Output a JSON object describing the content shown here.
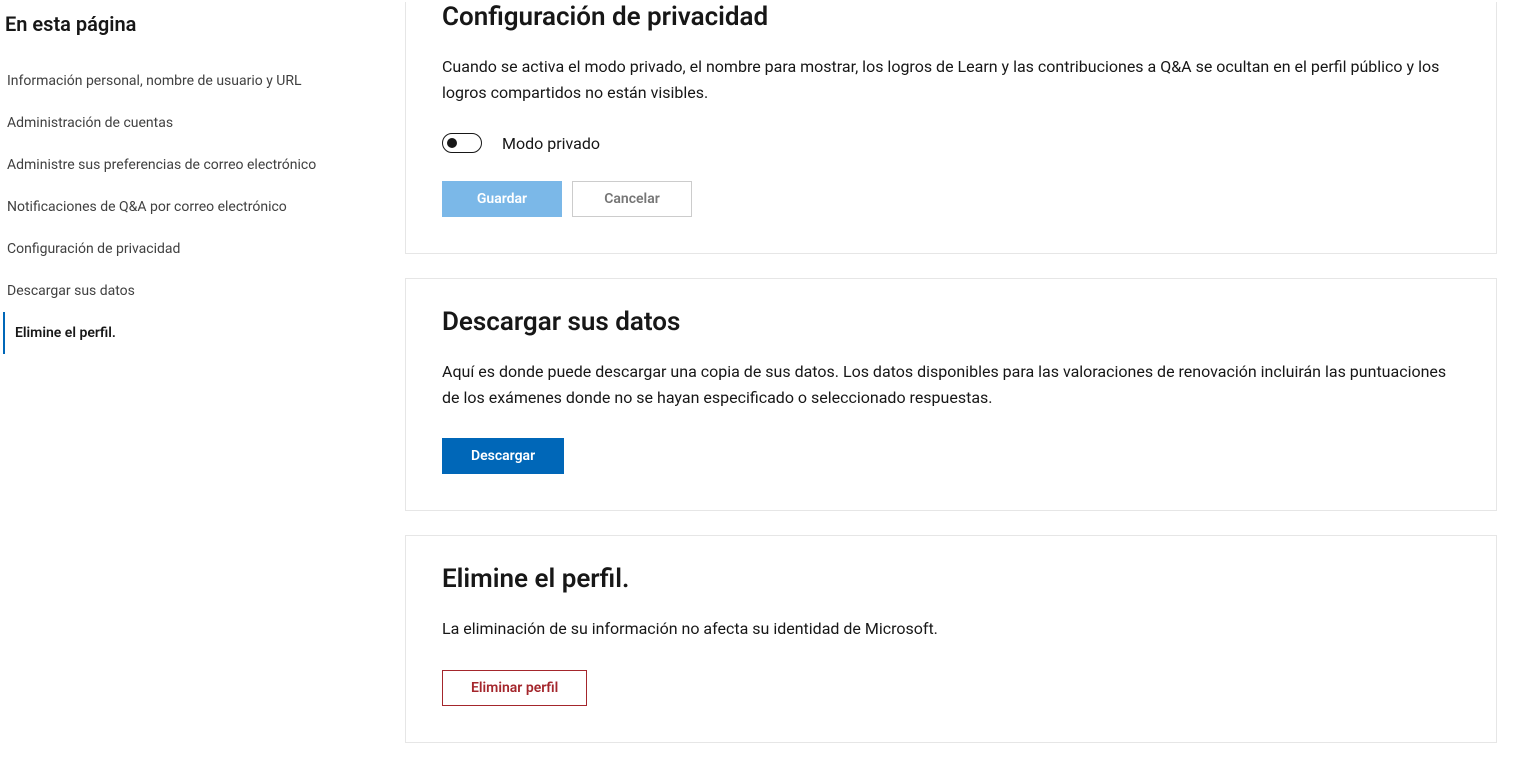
{
  "sidebar": {
    "title": "En esta página",
    "items": [
      {
        "label": "Información personal, nombre de usuario y URL",
        "active": false
      },
      {
        "label": "Administración de cuentas",
        "active": false
      },
      {
        "label": "Administre sus preferencias de correo electrónico",
        "active": false
      },
      {
        "label": "Notificaciones de Q&A por correo electrónico",
        "active": false
      },
      {
        "label": "Configuración de privacidad",
        "active": false
      },
      {
        "label": "Descargar sus datos",
        "active": false
      },
      {
        "label": "Elimine el perfil.",
        "active": true
      }
    ]
  },
  "privacy": {
    "title": "Configuración de privacidad",
    "desc": "Cuando se activa el modo privado, el nombre para mostrar, los logros de Learn y las contribuciones a Q&A se ocultan en el perfil público y los logros compartidos no están visibles.",
    "toggle_label": "Modo privado",
    "toggle_state": false,
    "save_label": "Guardar",
    "cancel_label": "Cancelar"
  },
  "download": {
    "title": "Descargar sus datos",
    "desc": "Aquí es donde puede descargar una copia de sus datos. Los datos disponibles para las valoraciones de renovación incluirán las puntuaciones de los exámenes donde no se hayan especificado o seleccionado respuestas.",
    "button_label": "Descargar"
  },
  "delete": {
    "title": "Elimine el perfil.",
    "desc": "La eliminación de su información no afecta su identidad de Microsoft.",
    "button_label": "Eliminar perfil"
  }
}
